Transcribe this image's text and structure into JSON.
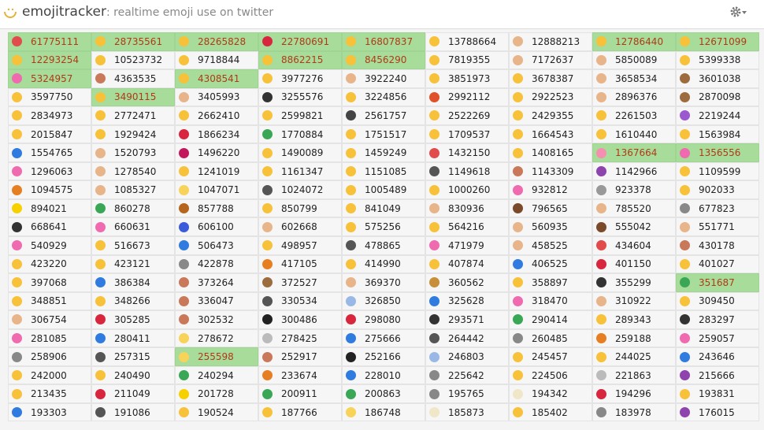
{
  "header": {
    "app_name": "emojitracker",
    "tagline": ": realtime emoji use on twitter"
  },
  "icons": {
    "logo": "smiling-face-icon",
    "settings": "gear-with-dropdown-icon"
  },
  "colors": {
    "highlight_bg": "#a7dc9a",
    "highlight_text": "#b13a16",
    "cell_bg": "#f6f6f6"
  },
  "rankings": [
    {
      "count": "61775111",
      "color": "#e24b4b",
      "hl": true
    },
    {
      "count": "28735561",
      "color": "#f7c23a",
      "hl": true
    },
    {
      "count": "28265828",
      "color": "#f7c23a",
      "hl": true
    },
    {
      "count": "22780691",
      "color": "#d7263d",
      "hl": true
    },
    {
      "count": "16807837",
      "color": "#f7c23a",
      "hl": true
    },
    {
      "count": "13788664",
      "color": "#f7c23a",
      "hl": false
    },
    {
      "count": "12888213",
      "color": "#e8b48a",
      "hl": false
    },
    {
      "count": "12786440",
      "color": "#f7c23a",
      "hl": true
    },
    {
      "count": "12671099",
      "color": "#f7c23a",
      "hl": true
    },
    {
      "count": "12293254",
      "color": "#f7c23a",
      "hl": true
    },
    {
      "count": "10523732",
      "color": "#f7c23a",
      "hl": false
    },
    {
      "count": "9718844",
      "color": "#f7c23a",
      "hl": false
    },
    {
      "count": "8862215",
      "color": "#f7c23a",
      "hl": true
    },
    {
      "count": "8456290",
      "color": "#f7c23a",
      "hl": true
    },
    {
      "count": "7819355",
      "color": "#f7c23a",
      "hl": false
    },
    {
      "count": "7172637",
      "color": "#e8b48a",
      "hl": false
    },
    {
      "count": "5850089",
      "color": "#e8b48a",
      "hl": false
    },
    {
      "count": "5399338",
      "color": "#f7c23a",
      "hl": false
    },
    {
      "count": "5324957",
      "color": "#f06ab0",
      "hl": true
    },
    {
      "count": "4363535",
      "color": "#c9785a",
      "hl": false
    },
    {
      "count": "4308541",
      "color": "#f7c23a",
      "hl": true
    },
    {
      "count": "3977276",
      "color": "#f7c23a",
      "hl": false
    },
    {
      "count": "3922240",
      "color": "#e8b48a",
      "hl": false
    },
    {
      "count": "3851973",
      "color": "#f7c23a",
      "hl": false
    },
    {
      "count": "3678387",
      "color": "#f7c23a",
      "hl": false
    },
    {
      "count": "3658534",
      "color": "#e8b48a",
      "hl": false
    },
    {
      "count": "3601038",
      "color": "#9c6b3e",
      "hl": false
    },
    {
      "count": "3597750",
      "color": "#f7c23a",
      "hl": false
    },
    {
      "count": "3490115",
      "color": "#f7c23a",
      "hl": true
    },
    {
      "count": "3405993",
      "color": "#e8b48a",
      "hl": false
    },
    {
      "count": "3255576",
      "color": "#333333",
      "hl": false
    },
    {
      "count": "3224856",
      "color": "#f7c23a",
      "hl": false
    },
    {
      "count": "2992112",
      "color": "#e0502a",
      "hl": false
    },
    {
      "count": "2922523",
      "color": "#f7c23a",
      "hl": false
    },
    {
      "count": "2896376",
      "color": "#e8b48a",
      "hl": false
    },
    {
      "count": "2870098",
      "color": "#9c6b3e",
      "hl": false
    },
    {
      "count": "2834973",
      "color": "#f7c23a",
      "hl": false
    },
    {
      "count": "2772471",
      "color": "#f7c23a",
      "hl": false
    },
    {
      "count": "2662410",
      "color": "#f7c23a",
      "hl": false
    },
    {
      "count": "2599821",
      "color": "#f7c23a",
      "hl": false
    },
    {
      "count": "2561757",
      "color": "#444444",
      "hl": false
    },
    {
      "count": "2522269",
      "color": "#f7c23a",
      "hl": false
    },
    {
      "count": "2429355",
      "color": "#f7c23a",
      "hl": false
    },
    {
      "count": "2261503",
      "color": "#f7c23a",
      "hl": false
    },
    {
      "count": "2219244",
      "color": "#9b59d0",
      "hl": false
    },
    {
      "count": "2015847",
      "color": "#f7c23a",
      "hl": false
    },
    {
      "count": "1929424",
      "color": "#f7c23a",
      "hl": false
    },
    {
      "count": "1866234",
      "color": "#d7263d",
      "hl": false
    },
    {
      "count": "1770884",
      "color": "#3aa757",
      "hl": false
    },
    {
      "count": "1751517",
      "color": "#f7c23a",
      "hl": false
    },
    {
      "count": "1709537",
      "color": "#f7c23a",
      "hl": false
    },
    {
      "count": "1664543",
      "color": "#f7c23a",
      "hl": false
    },
    {
      "count": "1610440",
      "color": "#f7c23a",
      "hl": false
    },
    {
      "count": "1563984",
      "color": "#f7c23a",
      "hl": false
    },
    {
      "count": "1554765",
      "color": "#2f7be0",
      "hl": false
    },
    {
      "count": "1520793",
      "color": "#e8b48a",
      "hl": false
    },
    {
      "count": "1496220",
      "color": "#c2185b",
      "hl": false
    },
    {
      "count": "1490089",
      "color": "#f7c23a",
      "hl": false
    },
    {
      "count": "1459249",
      "color": "#f7c23a",
      "hl": false
    },
    {
      "count": "1432150",
      "color": "#e24b4b",
      "hl": false
    },
    {
      "count": "1408165",
      "color": "#f7c23a",
      "hl": false
    },
    {
      "count": "1367664",
      "color": "#f48fb1",
      "hl": true
    },
    {
      "count": "1356556",
      "color": "#f06ab0",
      "hl": true
    },
    {
      "count": "1296063",
      "color": "#f06ab0",
      "hl": false
    },
    {
      "count": "1278540",
      "color": "#e8b48a",
      "hl": false
    },
    {
      "count": "1241019",
      "color": "#f7c23a",
      "hl": false
    },
    {
      "count": "1161347",
      "color": "#f7c23a",
      "hl": false
    },
    {
      "count": "1151085",
      "color": "#f7c23a",
      "hl": false
    },
    {
      "count": "1149618",
      "color": "#555555",
      "hl": false
    },
    {
      "count": "1143309",
      "color": "#c9785a",
      "hl": false
    },
    {
      "count": "1142966",
      "color": "#8e44ad",
      "hl": false
    },
    {
      "count": "1109599",
      "color": "#f7c23a",
      "hl": false
    },
    {
      "count": "1094575",
      "color": "#e67e22",
      "hl": false
    },
    {
      "count": "1085327",
      "color": "#e8b48a",
      "hl": false
    },
    {
      "count": "1047071",
      "color": "#f7d35a",
      "hl": false
    },
    {
      "count": "1024072",
      "color": "#555555",
      "hl": false
    },
    {
      "count": "1005489",
      "color": "#f7c23a",
      "hl": false
    },
    {
      "count": "1000260",
      "color": "#f7c23a",
      "hl": false
    },
    {
      "count": "932812",
      "color": "#f06ab0",
      "hl": false
    },
    {
      "count": "923378",
      "color": "#999999",
      "hl": false
    },
    {
      "count": "902033",
      "color": "#f7c23a",
      "hl": false
    },
    {
      "count": "894021",
      "color": "#f7d000",
      "hl": false
    },
    {
      "count": "860278",
      "color": "#3aa757",
      "hl": false
    },
    {
      "count": "857788",
      "color": "#b5651d",
      "hl": false
    },
    {
      "count": "850799",
      "color": "#f7c23a",
      "hl": false
    },
    {
      "count": "841049",
      "color": "#f7c23a",
      "hl": false
    },
    {
      "count": "830936",
      "color": "#e8b48a",
      "hl": false
    },
    {
      "count": "796565",
      "color": "#7b4a2a",
      "hl": false
    },
    {
      "count": "785520",
      "color": "#e8b48a",
      "hl": false
    },
    {
      "count": "677823",
      "color": "#888888",
      "hl": false
    },
    {
      "count": "668641",
      "color": "#333333",
      "hl": false
    },
    {
      "count": "660631",
      "color": "#f06ab0",
      "hl": false
    },
    {
      "count": "606100",
      "color": "#3b5bdb",
      "hl": false
    },
    {
      "count": "602668",
      "color": "#e8b48a",
      "hl": false
    },
    {
      "count": "575256",
      "color": "#f7c23a",
      "hl": false
    },
    {
      "count": "564216",
      "color": "#f7c23a",
      "hl": false
    },
    {
      "count": "560935",
      "color": "#e8b48a",
      "hl": false
    },
    {
      "count": "555042",
      "color": "#7b4a2a",
      "hl": false
    },
    {
      "count": "551771",
      "color": "#e8b48a",
      "hl": false
    },
    {
      "count": "540929",
      "color": "#f06ab0",
      "hl": false
    },
    {
      "count": "516673",
      "color": "#f7c23a",
      "hl": false
    },
    {
      "count": "506473",
      "color": "#2f7be0",
      "hl": false
    },
    {
      "count": "498957",
      "color": "#f7c23a",
      "hl": false
    },
    {
      "count": "478865",
      "color": "#555555",
      "hl": false
    },
    {
      "count": "471979",
      "color": "#f06ab0",
      "hl": false
    },
    {
      "count": "458525",
      "color": "#e8b48a",
      "hl": false
    },
    {
      "count": "434604",
      "color": "#e24b4b",
      "hl": false
    },
    {
      "count": "430178",
      "color": "#c9785a",
      "hl": false
    },
    {
      "count": "423220",
      "color": "#f7c23a",
      "hl": false
    },
    {
      "count": "423121",
      "color": "#f7c23a",
      "hl": false
    },
    {
      "count": "422878",
      "color": "#888888",
      "hl": false
    },
    {
      "count": "417105",
      "color": "#e67e22",
      "hl": false
    },
    {
      "count": "414990",
      "color": "#f7c23a",
      "hl": false
    },
    {
      "count": "407874",
      "color": "#f7c23a",
      "hl": false
    },
    {
      "count": "406525",
      "color": "#2f7be0",
      "hl": false
    },
    {
      "count": "401150",
      "color": "#d7263d",
      "hl": false
    },
    {
      "count": "401027",
      "color": "#f7c23a",
      "hl": false
    },
    {
      "count": "397068",
      "color": "#f7c23a",
      "hl": false
    },
    {
      "count": "386384",
      "color": "#2f7be0",
      "hl": false
    },
    {
      "count": "373264",
      "color": "#c9785a",
      "hl": false
    },
    {
      "count": "372527",
      "color": "#9c6b3e",
      "hl": false
    },
    {
      "count": "369370",
      "color": "#e8b48a",
      "hl": false
    },
    {
      "count": "360562",
      "color": "#c78f3a",
      "hl": false
    },
    {
      "count": "358897",
      "color": "#f7c23a",
      "hl": false
    },
    {
      "count": "355299",
      "color": "#333333",
      "hl": false
    },
    {
      "count": "351687",
      "color": "#3aa757",
      "hl": true
    },
    {
      "count": "348851",
      "color": "#f7c23a",
      "hl": false
    },
    {
      "count": "348266",
      "color": "#f7c23a",
      "hl": false
    },
    {
      "count": "336047",
      "color": "#c9785a",
      "hl": false
    },
    {
      "count": "330534",
      "color": "#555555",
      "hl": false
    },
    {
      "count": "326850",
      "color": "#9ab8e6",
      "hl": false
    },
    {
      "count": "325628",
      "color": "#2f7be0",
      "hl": false
    },
    {
      "count": "318470",
      "color": "#f06ab0",
      "hl": false
    },
    {
      "count": "310922",
      "color": "#e8b48a",
      "hl": false
    },
    {
      "count": "309450",
      "color": "#f7c23a",
      "hl": false
    },
    {
      "count": "306754",
      "color": "#e8b48a",
      "hl": false
    },
    {
      "count": "305285",
      "color": "#d7263d",
      "hl": false
    },
    {
      "count": "302532",
      "color": "#c9785a",
      "hl": false
    },
    {
      "count": "300486",
      "color": "#222222",
      "hl": false
    },
    {
      "count": "298080",
      "color": "#d7263d",
      "hl": false
    },
    {
      "count": "293571",
      "color": "#333333",
      "hl": false
    },
    {
      "count": "290414",
      "color": "#3aa757",
      "hl": false
    },
    {
      "count": "289343",
      "color": "#f7c23a",
      "hl": false
    },
    {
      "count": "283297",
      "color": "#333333",
      "hl": false
    },
    {
      "count": "281085",
      "color": "#f06ab0",
      "hl": false
    },
    {
      "count": "280411",
      "color": "#2f7be0",
      "hl": false
    },
    {
      "count": "278672",
      "color": "#f7d35a",
      "hl": false
    },
    {
      "count": "278425",
      "color": "#bbbbbb",
      "hl": false
    },
    {
      "count": "275666",
      "color": "#2f7be0",
      "hl": false
    },
    {
      "count": "264442",
      "color": "#555555",
      "hl": false
    },
    {
      "count": "260485",
      "color": "#888888",
      "hl": false
    },
    {
      "count": "259188",
      "color": "#e67e22",
      "hl": false
    },
    {
      "count": "259057",
      "color": "#f06ab0",
      "hl": false
    },
    {
      "count": "258906",
      "color": "#888888",
      "hl": false
    },
    {
      "count": "257315",
      "color": "#555555",
      "hl": false
    },
    {
      "count": "255598",
      "color": "#f7d35a",
      "hl": true
    },
    {
      "count": "252917",
      "color": "#c9785a",
      "hl": false
    },
    {
      "count": "252166",
      "color": "#222222",
      "hl": false
    },
    {
      "count": "246803",
      "color": "#9ab8e6",
      "hl": false
    },
    {
      "count": "245457",
      "color": "#f7c23a",
      "hl": false
    },
    {
      "count": "244025",
      "color": "#f7c23a",
      "hl": false
    },
    {
      "count": "243646",
      "color": "#2f7be0",
      "hl": false
    },
    {
      "count": "242000",
      "color": "#f7c23a",
      "hl": false
    },
    {
      "count": "240490",
      "color": "#f7c23a",
      "hl": false
    },
    {
      "count": "240294",
      "color": "#3aa757",
      "hl": false
    },
    {
      "count": "233674",
      "color": "#e67e22",
      "hl": false
    },
    {
      "count": "228010",
      "color": "#2f7be0",
      "hl": false
    },
    {
      "count": "225642",
      "color": "#888888",
      "hl": false
    },
    {
      "count": "224506",
      "color": "#f7c23a",
      "hl": false
    },
    {
      "count": "221863",
      "color": "#bbbbbb",
      "hl": false
    },
    {
      "count": "215666",
      "color": "#8e44ad",
      "hl": false
    },
    {
      "count": "213435",
      "color": "#f7c23a",
      "hl": false
    },
    {
      "count": "211049",
      "color": "#d7263d",
      "hl": false
    },
    {
      "count": "201728",
      "color": "#f7d000",
      "hl": false
    },
    {
      "count": "200911",
      "color": "#3aa757",
      "hl": false
    },
    {
      "count": "200863",
      "color": "#3aa757",
      "hl": false
    },
    {
      "count": "195765",
      "color": "#888888",
      "hl": false
    },
    {
      "count": "194342",
      "color": "#f0e6c8",
      "hl": false
    },
    {
      "count": "194296",
      "color": "#d7263d",
      "hl": false
    },
    {
      "count": "193831",
      "color": "#f7c23a",
      "hl": false
    },
    {
      "count": "193303",
      "color": "#2f7be0",
      "hl": false
    },
    {
      "count": "191086",
      "color": "#555555",
      "hl": false
    },
    {
      "count": "190524",
      "color": "#f7c23a",
      "hl": false
    },
    {
      "count": "187766",
      "color": "#f7c23a",
      "hl": false
    },
    {
      "count": "186748",
      "color": "#f7d35a",
      "hl": false
    },
    {
      "count": "185873",
      "color": "#f0e6c8",
      "hl": false
    },
    {
      "count": "185402",
      "color": "#f7c23a",
      "hl": false
    },
    {
      "count": "183978",
      "color": "#888888",
      "hl": false
    },
    {
      "count": "176015",
      "color": "#8e44ad",
      "hl": false
    }
  ]
}
